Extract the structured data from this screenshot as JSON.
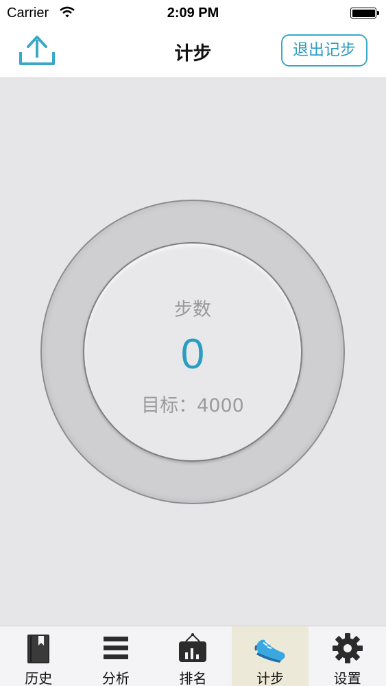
{
  "status_bar": {
    "carrier": "Carrier",
    "time": "2:09 PM"
  },
  "nav": {
    "title": "计步",
    "exit_label": "退出记步"
  },
  "steps": {
    "label": "步数",
    "count": "0",
    "goal": "目标：4000"
  },
  "tabs": [
    {
      "label": "历史",
      "icon": "book-icon"
    },
    {
      "label": "分析",
      "icon": "list-icon"
    },
    {
      "label": "排名",
      "icon": "ranking-board-icon"
    },
    {
      "label": "计步",
      "icon": "sneaker-icon",
      "active": true
    },
    {
      "label": "设置",
      "icon": "gear-icon"
    }
  ],
  "colors": {
    "accent": "#2c9dc2",
    "background": "#e6e6e8",
    "active_tab": "#ede9d8"
  }
}
